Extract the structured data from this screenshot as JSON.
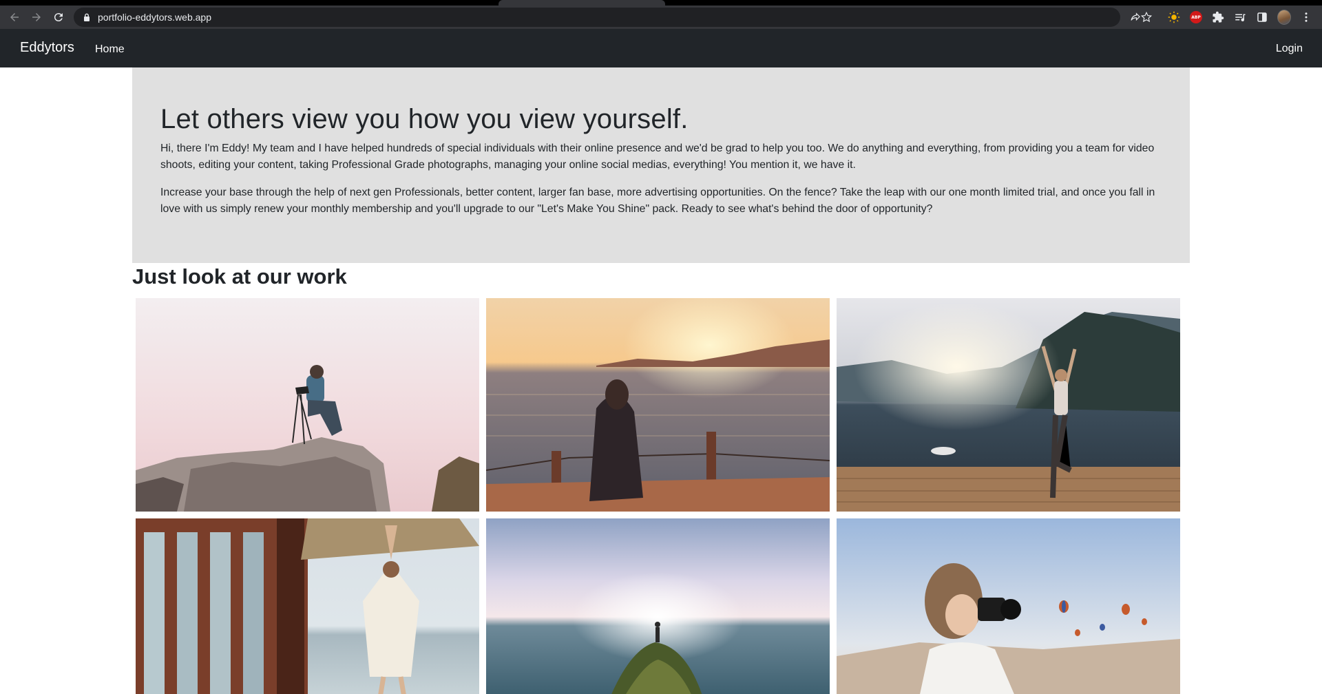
{
  "browser": {
    "url": "portfolio-eddytors.web.app",
    "icons": [
      "back-icon",
      "forward-icon",
      "reload-icon",
      "lock-icon",
      "share-icon",
      "bookmark-star-icon",
      "dark-reader-icon",
      "adblock-plus-icon",
      "extensions-icon",
      "reading-list-icon",
      "side-panel-icon",
      "profile-avatar",
      "menu-icon"
    ],
    "adblock_label": "ABP"
  },
  "navbar": {
    "brand": "Eddytors",
    "home": "Home",
    "login": "Login"
  },
  "hero": {
    "heading": "Let others view you how you view yourself.",
    "paragraph_1": "Hi, there I'm Eddy! My team and I have helped hundreds of special individuals with their online presence and we'd be grad to help you too. We do anything and everything, from providing you a team for video shoots, editing your content, taking Professional Grade photographs, managing your online social medias, everything! You mention it, we have it.",
    "paragraph_2": "Increase your base through the help of next gen Professionals, better content, larger fan base, more advertising opportunities. On the fence? Take the leap with our one month limited trial, and once you fall in love with us simply renew your monthly membership and you'll upgrade to our \"Let's Make You Shine\" pack. Ready to see what's behind the door of opportunity?"
  },
  "work": {
    "title": "Just look at our work",
    "photos": [
      "photographer-on-rock-photo",
      "woman-watching-sunset-photo",
      "yoga-on-dock-photo",
      "yoga-tree-pose-photo",
      "person-on-cliff-photo",
      "woman-with-camera-photo"
    ]
  },
  "colors": {
    "chrome_bg": "#35363a",
    "navbar_bg": "#212529",
    "hero_bg": "#e0e0e0",
    "text": "#212529"
  }
}
